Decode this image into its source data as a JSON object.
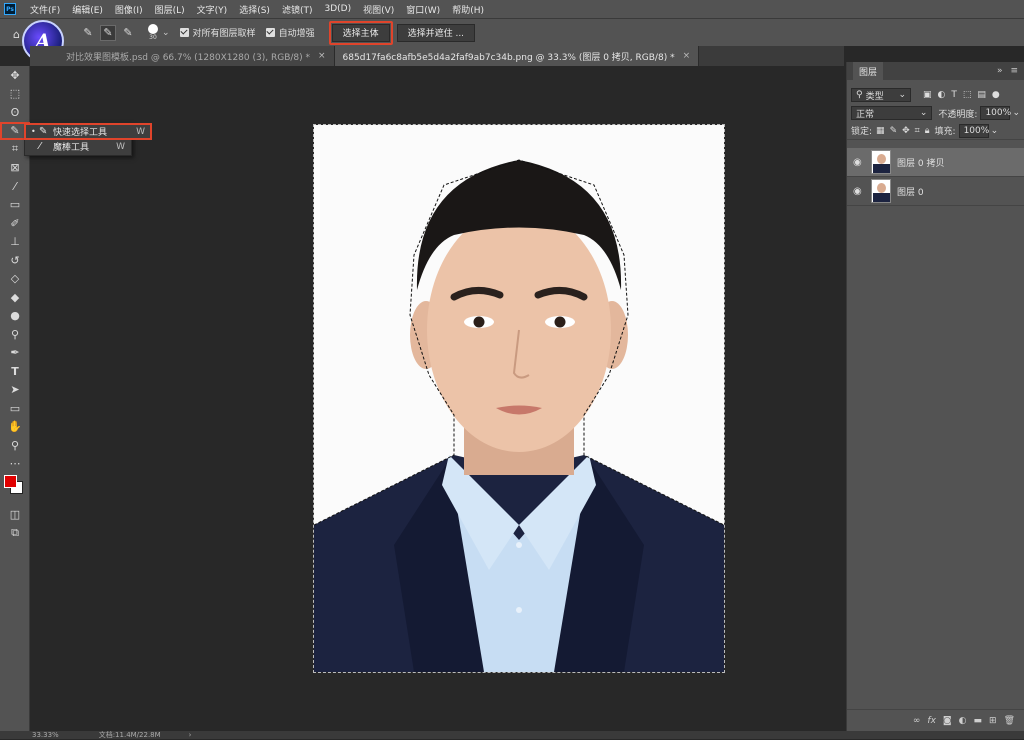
{
  "menubar": {
    "logo_text": "Ps",
    "items": [
      "文件(F)",
      "编辑(E)",
      "图像(I)",
      "图层(L)",
      "文字(Y)",
      "选择(S)",
      "滤镜(T)",
      "3D(D)",
      "视图(V)",
      "窗口(W)",
      "帮助(H)"
    ]
  },
  "options": {
    "brush_size": "30",
    "sample_all_layers": "对所有图层取样",
    "auto_enhance": "自动增强",
    "select_subject": "选择主体",
    "select_mask": "选择并遮住 ..."
  },
  "tabs": [
    {
      "label": "对比效果图模板.psd @ 66.7% (1280X1280 (3), RGB/8) *",
      "active": false
    },
    {
      "label": "685d17fa6c8afb5e5d4a2faf9ab7c34b.png @ 33.3% (图层 0 拷贝, RGB/8) *",
      "active": true
    }
  ],
  "flyout": {
    "items": [
      {
        "label": "快速选择工具",
        "key": "W",
        "current": true
      },
      {
        "label": "魔棒工具",
        "key": "W",
        "current": false
      }
    ]
  },
  "layers_panel": {
    "title": "图层",
    "filter_label": "类型",
    "blend_mode": "正常",
    "opacity_label": "不透明度:",
    "opacity_value": "100%",
    "lock_label": "锁定:",
    "fill_label": "填充:",
    "fill_value": "100%",
    "layers": [
      {
        "name": "图层 0 拷贝",
        "selected": true
      },
      {
        "name": "图层 0",
        "selected": false
      }
    ]
  },
  "status": {
    "zoom": "33.33%",
    "doc_size": "文档:11.4M/22.8M"
  },
  "colors": {
    "foreground": "#e00000",
    "background": "#ffffff",
    "highlight": "#e0442b"
  }
}
